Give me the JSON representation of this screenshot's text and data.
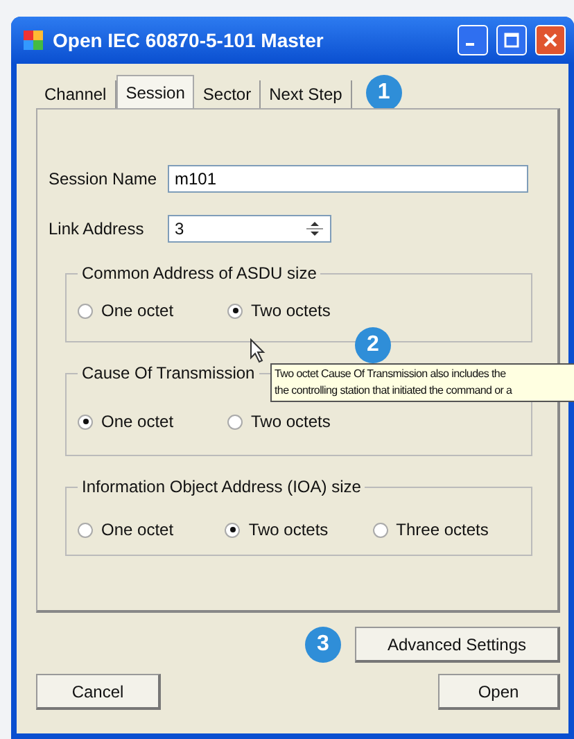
{
  "window": {
    "title": "Open IEC 60870-5-101 Master"
  },
  "tabs": [
    {
      "label": "Channel",
      "selected": false
    },
    {
      "label": "Session",
      "selected": true
    },
    {
      "label": "Sector",
      "selected": false
    },
    {
      "label": "Next Step",
      "selected": false
    }
  ],
  "callouts": [
    "1",
    "2",
    "3"
  ],
  "session_name": {
    "label": "Session Name",
    "value": "m101"
  },
  "link_address": {
    "label": "Link Address",
    "value": "3"
  },
  "groups": [
    {
      "title": "Common Address of ASDU size",
      "options": [
        {
          "label": "One octet",
          "selected": false
        },
        {
          "label": "Two octets",
          "selected": true
        }
      ]
    },
    {
      "title": "Cause Of  Transmission",
      "options": [
        {
          "label": "One octet",
          "selected": true
        },
        {
          "label": "Two octets",
          "selected": false
        }
      ]
    },
    {
      "title": "Information Object Address (IOA) size",
      "options": [
        {
          "label": "One octet",
          "selected": false
        },
        {
          "label": "Two octets",
          "selected": true
        },
        {
          "label": "Three octets",
          "selected": false
        }
      ]
    }
  ],
  "tooltip": {
    "lines": [
      "Two octet Cause Of Transmission also includes the",
      "the controlling station that initiated the command or a"
    ]
  },
  "buttons": {
    "advanced": "Advanced Settings",
    "cancel": "Cancel",
    "open": "Open"
  }
}
